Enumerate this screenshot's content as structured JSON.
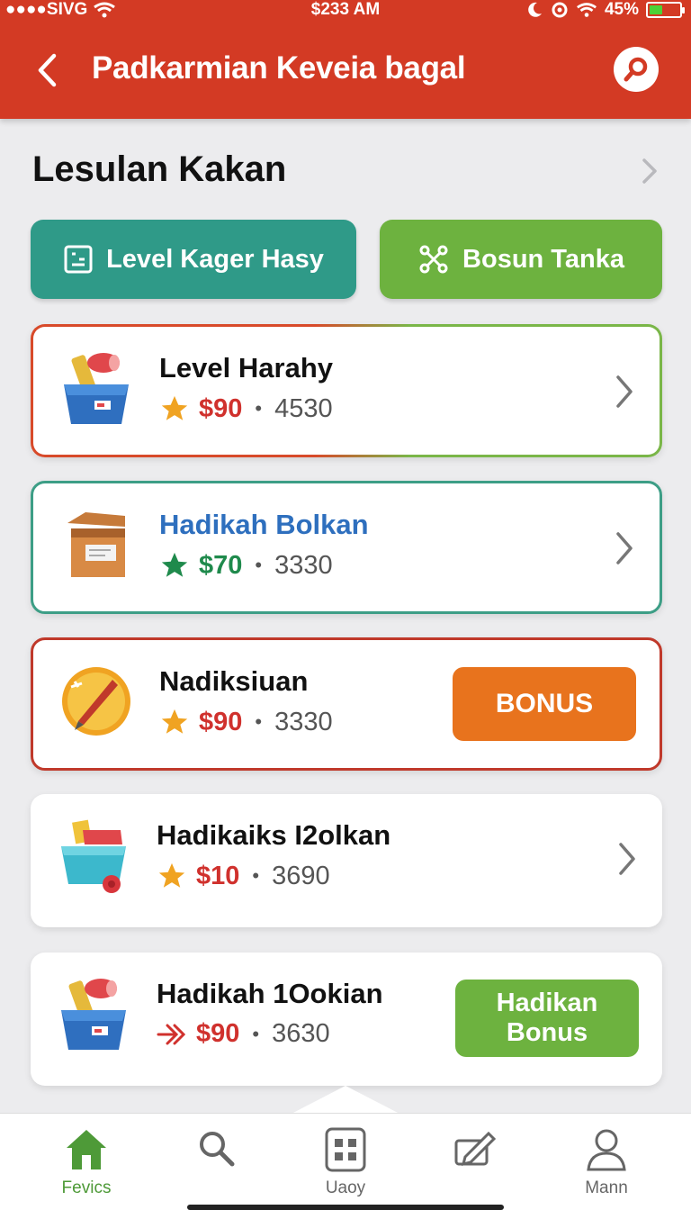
{
  "status_bar": {
    "carrier": "●●●●SIVG",
    "time": "$233 AM",
    "battery_percent": "45%",
    "battery_level": 0.45
  },
  "header": {
    "title": "Padkarmian Keveia bagal"
  },
  "section": {
    "title": "Lesulan Kakan"
  },
  "filters": [
    {
      "label": "Level Kager Hasy",
      "icon": "list-square-icon",
      "color": "#2f9a88"
    },
    {
      "label": "Bosun Tanka",
      "icon": "network-icon",
      "color": "#6db23f"
    }
  ],
  "items": [
    {
      "title": "Level Harahy",
      "icon": "toolbox-icon",
      "rating_icon": "star-icon",
      "price": "$90",
      "count": "4530",
      "price_color": "#d0312d",
      "title_color": "#111111",
      "action": "chevron"
    },
    {
      "title": "Hadikah Bolkan",
      "icon": "crate-icon",
      "rating_icon": "star-icon",
      "price": "$70",
      "count": "3330",
      "price_color": "#1f8a4c",
      "title_color": "#2e6fbe",
      "action": "chevron"
    },
    {
      "title": "Nadiksiuan",
      "icon": "coin-icon",
      "rating_icon": "star-icon",
      "price": "$90",
      "count": "3330",
      "price_color": "#d0312d",
      "title_color": "#111111",
      "action": "button",
      "action_label": "BONUS"
    },
    {
      "title": "Hadikaiks I2olkan",
      "icon": "basket-icon",
      "rating_icon": "star-icon",
      "price": "$10",
      "count": "3690",
      "price_color": "#d0312d",
      "title_color": "#111111",
      "action": "chevron"
    },
    {
      "title": "Hadikah 1Ookian",
      "icon": "toolbox-icon",
      "rating_icon": "arrow-icon",
      "price": "$90",
      "count": "3630",
      "price_color": "#d0312d",
      "title_color": "#111111",
      "action": "button",
      "action_label": "Hadikan Bonus"
    }
  ],
  "bottom_nav": [
    {
      "label": "Fevics",
      "icon": "home-icon",
      "active": true
    },
    {
      "label": "",
      "icon": "search-icon",
      "active": false
    },
    {
      "label": "Uaoy",
      "icon": "grid-icon",
      "active": false
    },
    {
      "label": "",
      "icon": "edit-icon",
      "active": false
    },
    {
      "label": "Mann",
      "icon": "person-icon",
      "active": false
    }
  ],
  "colors": {
    "header": "#d33a24",
    "bonus_orange": "#e8731d",
    "bonus_green": "#6db23f",
    "active_nav": "#4e9a38"
  }
}
